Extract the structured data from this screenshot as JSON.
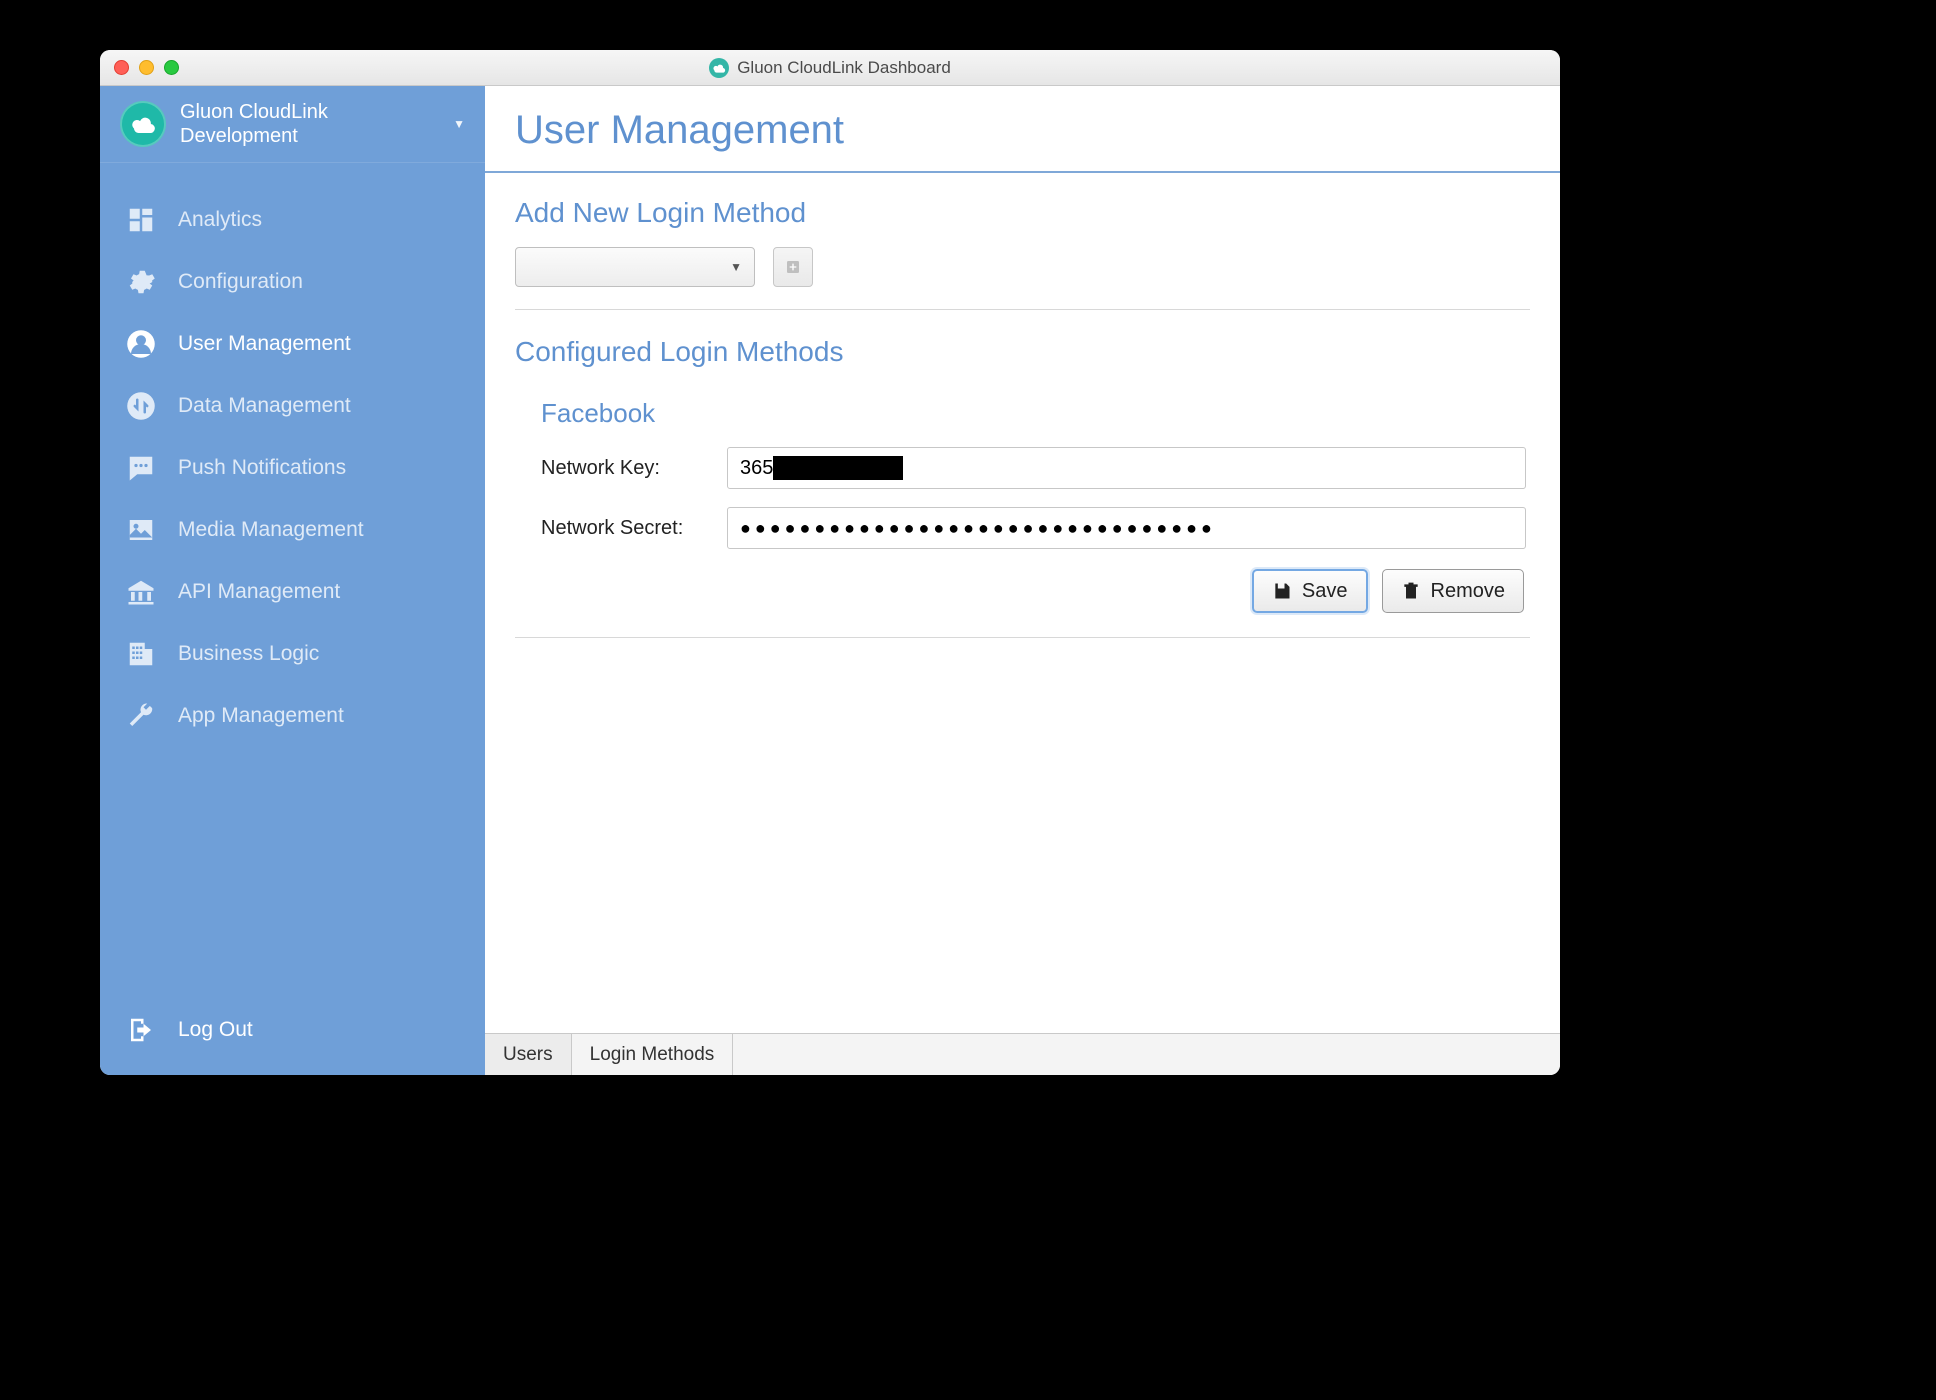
{
  "window": {
    "title": "Gluon CloudLink Dashboard"
  },
  "sidebar": {
    "app_name_line1": "Gluon CloudLink",
    "app_name_line2": "Development",
    "items": [
      {
        "label": "Analytics"
      },
      {
        "label": "Configuration"
      },
      {
        "label": "User Management"
      },
      {
        "label": "Data Management"
      },
      {
        "label": "Push Notifications"
      },
      {
        "label": "Media Management"
      },
      {
        "label": "API Management"
      },
      {
        "label": "Business Logic"
      },
      {
        "label": "App Management"
      }
    ],
    "logout_label": "Log Out"
  },
  "page": {
    "title": "User Management",
    "add_section_title": "Add New Login Method",
    "configured_section_title": "Configured Login Methods"
  },
  "login_method": {
    "provider": "Facebook",
    "network_key_label": "Network Key:",
    "network_key_prefix": "365",
    "network_secret_label": "Network Secret:",
    "network_secret_masked": "●●●●●●●●●●●●●●●●●●●●●●●●●●●●●●●●"
  },
  "buttons": {
    "save": "Save",
    "remove": "Remove"
  },
  "tabs": {
    "users": "Users",
    "login_methods": "Login Methods"
  }
}
